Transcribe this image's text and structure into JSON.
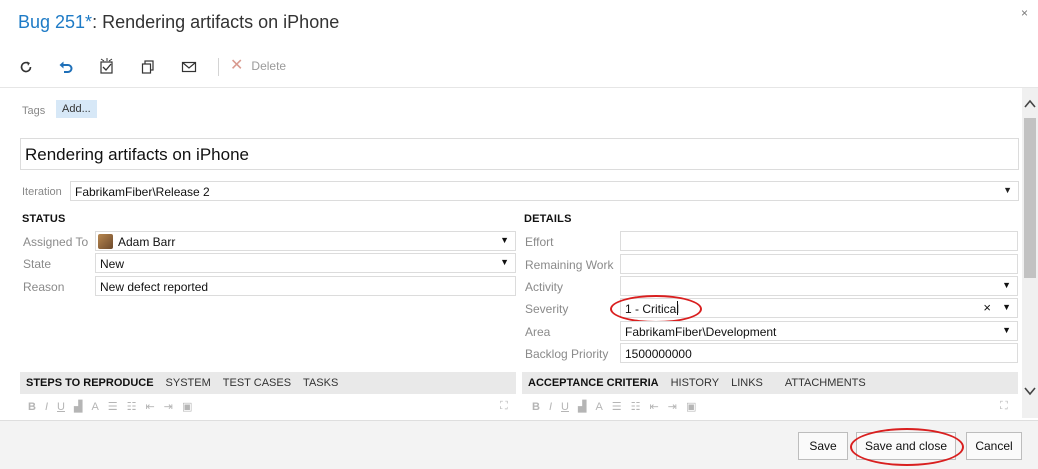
{
  "window": {
    "bug_id": "Bug 251*",
    "title_rest": ": Rendering artifacts on iPhone",
    "close_glyph": "×"
  },
  "toolbar": {
    "delete_label": "Delete"
  },
  "tags": {
    "label": "Tags",
    "add_label": "Add..."
  },
  "work_item": {
    "title_value": "Rendering artifacts on iPhone"
  },
  "iteration": {
    "label": "Iteration",
    "value": "FabrikamFiber\\Release 2"
  },
  "status": {
    "heading": "STATUS",
    "assigned_to_label": "Assigned To",
    "assigned_to_value": "Adam Barr",
    "state_label": "State",
    "state_value": "New",
    "reason_label": "Reason",
    "reason_value": "New defect reported"
  },
  "details": {
    "heading": "DETAILS",
    "effort_label": "Effort",
    "effort_value": "",
    "remaining_work_label": "Remaining Work",
    "remaining_work_value": "",
    "activity_label": "Activity",
    "activity_value": "",
    "severity_label": "Severity",
    "severity_value": "1 - Critical",
    "area_label": "Area",
    "area_value": "FabrikamFiber\\Development",
    "backlog_priority_label": "Backlog Priority",
    "backlog_priority_value": "1500000000"
  },
  "left_tabs": [
    "STEPS TO REPRODUCE",
    "SYSTEM",
    "TEST CASES",
    "TASKS"
  ],
  "right_tabs": [
    "ACCEPTANCE CRITERIA",
    "HISTORY",
    "LINKS",
    "ATTACHMENTS"
  ],
  "footer": {
    "save_label": "Save",
    "save_close_label": "Save and close",
    "cancel_label": "Cancel"
  },
  "colors": {
    "accent": "#1e7bc6",
    "highlight_ring": "#d91f1f",
    "tag_bg": "#d7e8f7"
  }
}
